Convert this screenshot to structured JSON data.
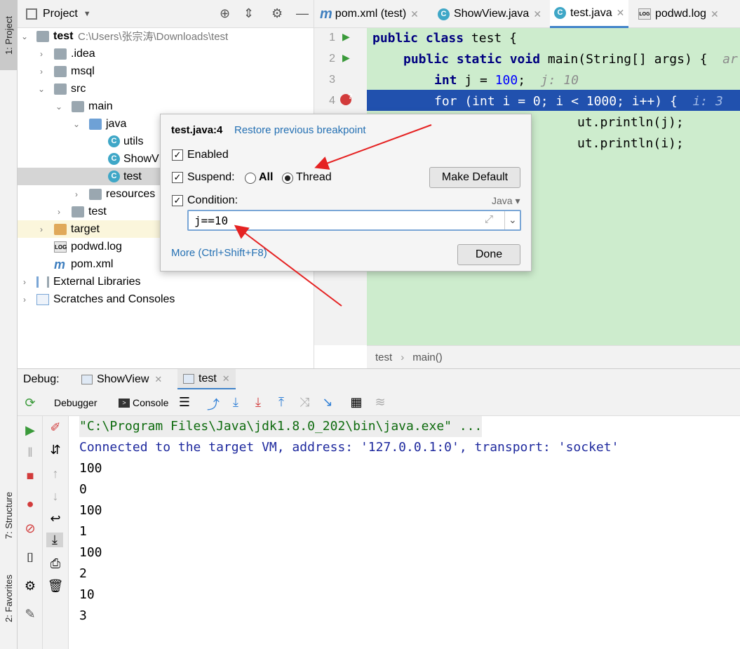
{
  "left_strip": {
    "project_tab": "1: Project",
    "structure_tab": "7: Structure",
    "favorites_tab": "2: Favorites"
  },
  "project": {
    "title": "Project",
    "tree": [
      {
        "label": "test",
        "path": "C:\\Users\\张宗涛\\Downloads\\test"
      },
      {
        "label": ".idea"
      },
      {
        "label": "msql"
      },
      {
        "label": "src"
      },
      {
        "label": "main"
      },
      {
        "label": "java"
      },
      {
        "label": "utils"
      },
      {
        "label": "ShowV"
      },
      {
        "label": "test"
      },
      {
        "label": "resources"
      },
      {
        "label": "test"
      },
      {
        "label": "target"
      },
      {
        "label": "podwd.log"
      },
      {
        "label": "pom.xml"
      },
      {
        "label": "External Libraries"
      },
      {
        "label": "Scratches and Consoles"
      }
    ]
  },
  "editor": {
    "tabs": [
      {
        "label": "pom.xml (test)"
      },
      {
        "label": "ShowView.java"
      },
      {
        "label": "test.java"
      },
      {
        "label": "podwd.log"
      }
    ],
    "line_numbers": [
      "1",
      "2",
      "3",
      "4"
    ],
    "code": {
      "l1_kw": "public class ",
      "l1_rest": "test {",
      "l2_kw": "public static void ",
      "l2_rest": "main(String[] args) {  ",
      "l2_hint": "ar",
      "l3_kw": "int ",
      "l3_rest": "j = ",
      "l3_num": "100",
      "l3_semi": ";  ",
      "l3_hint": "j: 10",
      "l4_text": "for (int i = 0; i < 1000; i++) {  ",
      "l4_hint": "i: 3",
      "l5_tail": "ut.println(j);",
      "l6_tail": "ut.println(i);"
    },
    "breadcrumb": {
      "class": "test",
      "sep": "›",
      "method": "main()"
    }
  },
  "popup": {
    "location": "test.java:4",
    "restore_link": "Restore previous breakpoint",
    "enabled_label": "Enabled",
    "suspend_label": "Suspend:",
    "suspend_all": "All",
    "suspend_thread": "Thread",
    "make_default": "Make Default",
    "condition_label": "Condition:",
    "language": "Java",
    "condition_value": "j==10",
    "more_link": "More (Ctrl+Shift+F8)",
    "done": "Done"
  },
  "debug": {
    "label": "Debug:",
    "tabs": [
      {
        "label": "ShowView"
      },
      {
        "label": "test"
      }
    ],
    "debugger_tab": "Debugger",
    "console_tab": "Console",
    "console_lines": [
      "\"C:\\Program Files\\Java\\jdk1.8.0_202\\bin\\java.exe\" ...",
      "Connected to the target VM, address: '127.0.0.1:0', transport: 'socket'",
      "100",
      "0",
      "100",
      "1",
      "100",
      "2",
      "10",
      "3"
    ]
  },
  "colors": {
    "accent": "#4083c9",
    "code_bg": "#cdeccd",
    "current_line": "#2151ae",
    "link": "#2470b3",
    "arrow": "#e52222"
  }
}
